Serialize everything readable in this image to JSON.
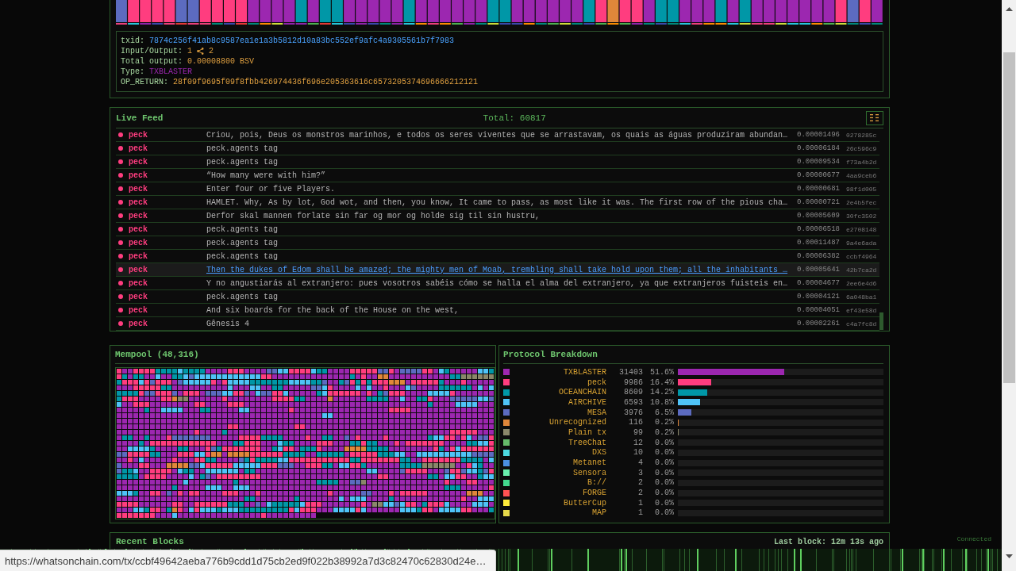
{
  "transaction": {
    "fields": [
      {
        "kind": "link",
        "label": "txid:",
        "value": "7874c256f41ab8c9587ea1e1a3b5812d10a83bc552ef9afc4a9305561b7f7983"
      },
      {
        "kind": "io",
        "label": "Input/Output:",
        "inputs": "1",
        "outputs": "2"
      },
      {
        "kind": "text",
        "label": "Total output:",
        "value": "0.00008800 BSV"
      },
      {
        "kind": "type",
        "label": "Type:",
        "value": "TXBLASTER",
        "color": "#9c27b0"
      },
      {
        "kind": "text",
        "label": "OP_RETURN:",
        "value": "28f09f9695f09f8fbb426974436f696e205363616c6573205374696666212121"
      }
    ]
  },
  "live_feed": {
    "title": "Live Feed",
    "total": "Total: 60817",
    "rows": [
      {
        "protocol": "peck",
        "color": "#ff3d7f",
        "message": "Criou, pois, Deus os monstros marinhos, e todos os seres viventes que se arrastavam, os quais as águas produziram abundan…",
        "amount": "0.00001496",
        "hash": "0278285c",
        "highlighted": false
      },
      {
        "protocol": "peck",
        "color": "#ff3d7f",
        "message": "peck.agents tag",
        "amount": "0.00006184",
        "hash": "26c596c9",
        "highlighted": false
      },
      {
        "protocol": "peck",
        "color": "#ff3d7f",
        "message": "peck.agents tag",
        "amount": "0.00009534",
        "hash": "f73a4b2d",
        "highlighted": false
      },
      {
        "protocol": "peck",
        "color": "#ff3d7f",
        "message": "“How many were with him?”",
        "amount": "0.00000677",
        "hash": "4aa9ceb6",
        "highlighted": false
      },
      {
        "protocol": "peck",
        "color": "#ff3d7f",
        "message": "Enter four or five Players.",
        "amount": "0.00000681",
        "hash": "98f1d005",
        "highlighted": false
      },
      {
        "protocol": "peck",
        "color": "#ff3d7f",
        "message": "HAMLET. Why, As by lot, God wot, and then, you know, It came to pass, as most like it was. The first row of the pious cha…",
        "amount": "0.00000721",
        "hash": "2e4b5fec",
        "highlighted": false
      },
      {
        "protocol": "peck",
        "color": "#ff3d7f",
        "message": "Derfor skal mannen forlate sin far og mor og holde sig til sin hustru,",
        "amount": "0.00005609",
        "hash": "30fc3502",
        "highlighted": false
      },
      {
        "protocol": "peck",
        "color": "#ff3d7f",
        "message": "peck.agents tag",
        "amount": "0.00006518",
        "hash": "e2708148",
        "highlighted": false
      },
      {
        "protocol": "peck",
        "color": "#ff3d7f",
        "message": "peck.agents tag",
        "amount": "0.00011487",
        "hash": "9a4e6ada",
        "highlighted": false
      },
      {
        "protocol": "peck",
        "color": "#ff3d7f",
        "message": "peck.agents tag",
        "amount": "0.00006382",
        "hash": "ccbf4964",
        "highlighted": false
      },
      {
        "protocol": "peck",
        "color": "#ff3d7f",
        "message": "Then the dukes of Edom shall be amazed; the mighty men of Moab, trembling shall take hold upon them; all the inhabitants …",
        "amount": "0.00005641",
        "hash": "42b7ca2d",
        "highlighted": true
      },
      {
        "protocol": "peck",
        "color": "#ff3d7f",
        "message": "Y no angustiarás al extranjero: pues vosotros sabéis cómo se halla el alma del extranjero, ya que extranjeros fuisteis en…",
        "amount": "0.00004677",
        "hash": "2ee6e4d6",
        "highlighted": false
      },
      {
        "protocol": "peck",
        "color": "#ff3d7f",
        "message": "peck.agents tag",
        "amount": "0.00004121",
        "hash": "6a048ba1",
        "highlighted": false
      },
      {
        "protocol": "peck",
        "color": "#ff3d7f",
        "message": "And six boards for the back of the House on the west,",
        "amount": "0.00004051",
        "hash": "ef43e58d",
        "highlighted": false
      },
      {
        "protocol": "peck",
        "color": "#ff3d7f",
        "message": "Gênesis 4",
        "amount": "0.00002261",
        "hash": "c4a7fc8d",
        "highlighted": false
      }
    ]
  },
  "mempool": {
    "title": "Mempool (48,316)"
  },
  "protocol_breakdown": {
    "title": "Protocol Breakdown",
    "protocols": [
      {
        "name": "TXBLASTER",
        "color": "#9c27b0",
        "count": "31403",
        "percent": "51.6%",
        "level": 0.516
      },
      {
        "name": "peck",
        "color": "#ff3d7f",
        "count": "9986",
        "percent": "16.4%",
        "level": 0.164
      },
      {
        "name": "OCEANCHAIN",
        "color": "#0097a7",
        "count": "8609",
        "percent": "14.2%",
        "level": 0.142
      },
      {
        "name": "AIRCHIVE",
        "color": "#4fc3f7",
        "count": "6593",
        "percent": "10.8%",
        "level": 0.108
      },
      {
        "name": "MESA",
        "color": "#5c6bc0",
        "count": "3976",
        "percent": "6.5%",
        "level": 0.065
      },
      {
        "name": "Unrecognized",
        "color": "#e0873a",
        "count": "116",
        "percent": "0.2%",
        "level": 0.002
      },
      {
        "name": "Plain tx",
        "color": "#8a876a",
        "count": "99",
        "percent": "0.2%",
        "level": 0.002
      },
      {
        "name": "TreeChat",
        "color": "#66bb6a",
        "count": "12",
        "percent": "0.0%"
      },
      {
        "name": "DXS",
        "color": "#4dd9e0",
        "count": "10",
        "percent": "0.0%"
      },
      {
        "name": "Metanet",
        "color": "#4a8fe2",
        "count": "4",
        "percent": "0.0%"
      },
      {
        "name": "Sensora",
        "color": "#69f0ae",
        "count": "3",
        "percent": "0.0%"
      },
      {
        "name": "B://",
        "color": "#43d98f",
        "count": "2",
        "percent": "0.0%"
      },
      {
        "name": "FORGE",
        "color": "#ff5252",
        "count": "2",
        "percent": "0.0%"
      },
      {
        "name": "ButterCup",
        "color": "#ffeb3b",
        "count": "1",
        "percent": "0.0%"
      },
      {
        "name": "MAP",
        "color": "#e6d84a",
        "count": "1",
        "percent": "0.0%"
      }
    ]
  },
  "recent_blocks": {
    "title": "Recent Blocks",
    "last_block": "Last block: 12m 13s ago"
  },
  "connection_status": "Connected",
  "browser": {
    "status_url": "https://whatsonchain.com/tx/ccbf49642aeba776b9cdd1d75cb2ed9f022b38992a7d3c82470c62830d24e…"
  }
}
